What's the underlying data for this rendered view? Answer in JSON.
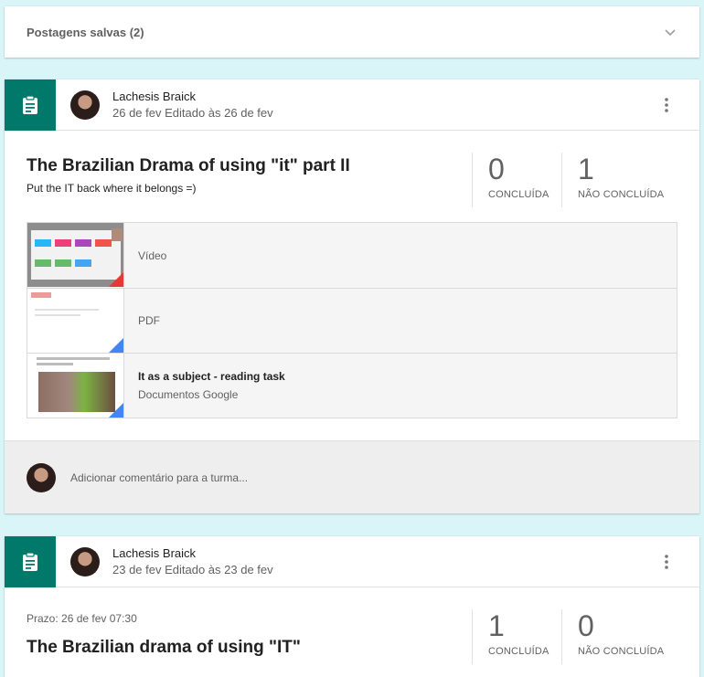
{
  "saved_posts": {
    "label": "Postagens salvas (2)"
  },
  "posts": [
    {
      "author": "Lachesis Braick",
      "date": "26 de fev Editado às 26 de fev",
      "title": "The Brazilian Drama of using \"it\" part II",
      "description": "Put the IT back where it belongs =)",
      "stats": {
        "done": "0",
        "done_label": "CONCLUÍDA",
        "not_done": "1",
        "not_done_label": "NÃO CONCLUÍDA"
      },
      "attachments": [
        {
          "name": "",
          "type": "Vídeo",
          "icon": "video-icon",
          "corner_color": "#e53935"
        },
        {
          "name": "",
          "type": "PDF",
          "icon": "pdf-icon",
          "corner_color": "#4285f4"
        },
        {
          "name": "It as a subject - reading task",
          "type": "Documentos Google",
          "icon": "docs-icon",
          "corner_color": "#4285f4"
        }
      ],
      "comment_placeholder": "Adicionar comentário para a turma..."
    },
    {
      "author": "Lachesis Braick",
      "date": "23 de fev Editado às 23 de fev",
      "deadline": "Prazo: 26 de fev 07:30",
      "title": "The Brazilian drama of using \"IT\"",
      "stats": {
        "done": "1",
        "done_label": "CONCLUÍDA",
        "not_done": "0",
        "not_done_label": "NÃO CONCLUÍDA"
      }
    }
  ],
  "colors": {
    "accent": "#00796b",
    "background": "#d9f5f8"
  }
}
